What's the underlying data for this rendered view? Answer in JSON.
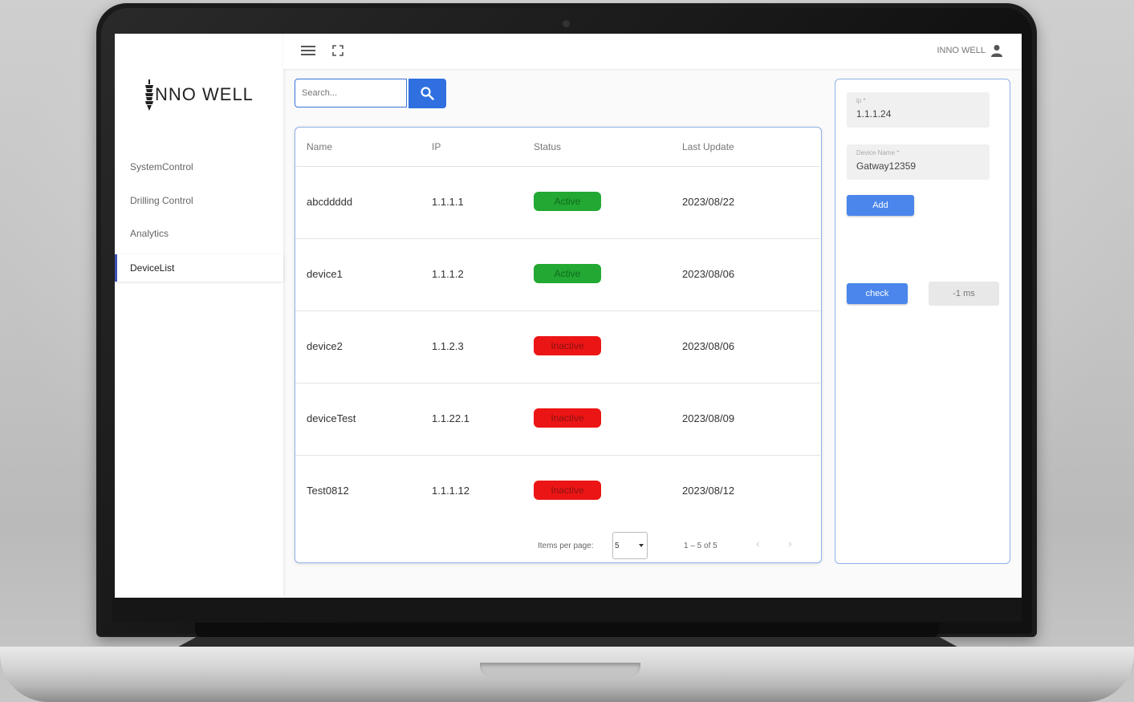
{
  "brand": {
    "name": "NNO WELL"
  },
  "topbar": {
    "user_name": "INNO WELL"
  },
  "sidebar": {
    "items": [
      {
        "label": "SystemControl",
        "active": false
      },
      {
        "label": "Drilling Control",
        "active": false
      },
      {
        "label": "Analytics",
        "active": false
      },
      {
        "label": "DeviceList",
        "active": true
      }
    ]
  },
  "search": {
    "placeholder": "Search..."
  },
  "table": {
    "columns": [
      "Name",
      "IP",
      "Status",
      "Last Update"
    ],
    "rows": [
      {
        "name": "abcddddd",
        "ip": "1.1.1.1",
        "status": "Active",
        "last_update": "2023/08/22"
      },
      {
        "name": "device1",
        "ip": "1.1.1.2",
        "status": "Active",
        "last_update": "2023/08/06"
      },
      {
        "name": "device2",
        "ip": "1.1.2.3",
        "status": "Inactive",
        "last_update": "2023/08/06"
      },
      {
        "name": "deviceTest",
        "ip": "1.1.22.1",
        "status": "Inactive",
        "last_update": "2023/08/09"
      },
      {
        "name": "Test0812",
        "ip": "1.1.1.12",
        "status": "Inactive",
        "last_update": "2023/08/12"
      }
    ],
    "paginator": {
      "items_per_page_label": "Items per page:",
      "page_size": "5",
      "range_label": "1 – 5 of 5"
    }
  },
  "form": {
    "ip_label": "ip *",
    "ip_value": "1.1.1.24",
    "device_name_label": "Device Name *",
    "device_name_value": "Gatway12359",
    "add_label": "Add",
    "check_label": "check",
    "latency": "-1 ms"
  },
  "colors": {
    "accent": "#2f6fe0",
    "active": "#22a833",
    "inactive": "#ec1515",
    "nav_indicator": "#3f51b5"
  },
  "icons": {
    "menu": "menu-icon",
    "fullscreen": "fullscreen-icon",
    "user": "user-icon",
    "search": "search-icon"
  }
}
